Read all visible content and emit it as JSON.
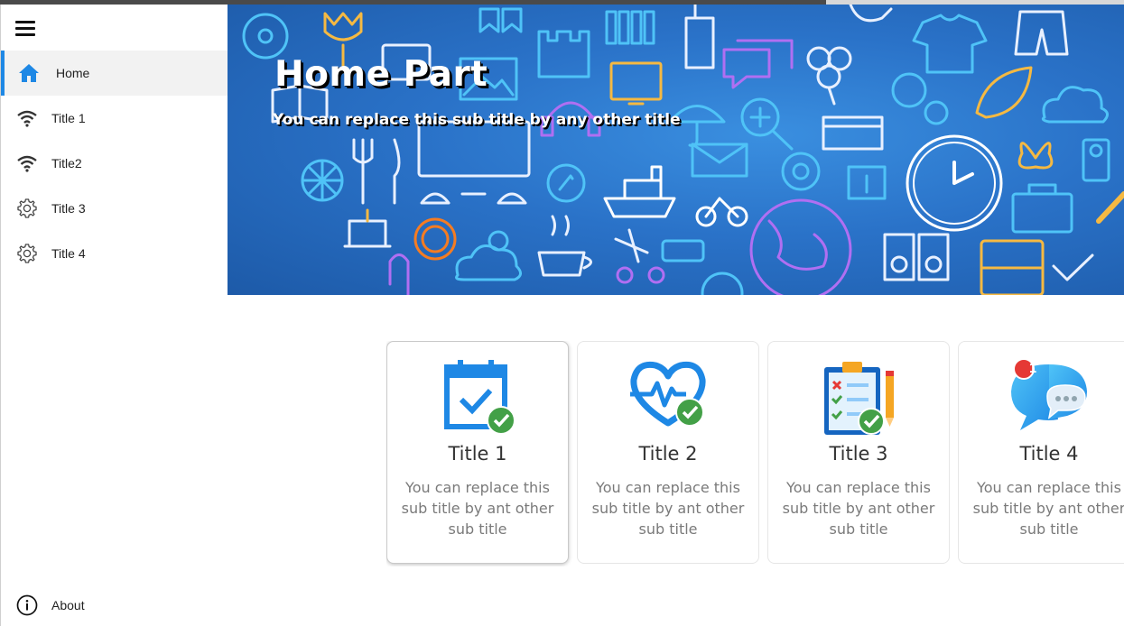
{
  "nav": {
    "items": [
      {
        "label": "Home",
        "icon": "home-icon",
        "active": true
      },
      {
        "label": "Title 1",
        "icon": "wifi-icon"
      },
      {
        "label": "Title2",
        "icon": "wifi-icon"
      },
      {
        "label": "Title 3",
        "icon": "gear-icon"
      },
      {
        "label": "Title 4",
        "icon": "gear-icon"
      }
    ],
    "about": {
      "label": "About",
      "icon": "info-icon"
    }
  },
  "hero": {
    "title": "Home Part",
    "subtitle": "You can replace this sub title by any other title"
  },
  "cards": [
    {
      "title": "Title 1",
      "sub": "You can replace this sub title by ant other sub title",
      "icon": "calendar-check-icon"
    },
    {
      "title": "Title 2",
      "sub": "You can replace this sub title by ant other sub title",
      "icon": "heart-pulse-icon"
    },
    {
      "title": "Title 3",
      "sub": "You can replace this sub title by ant other sub title",
      "icon": "clipboard-checklist-icon"
    },
    {
      "title": "Title 4",
      "sub": "You can replace this sub title by ant other sub title",
      "icon": "chat-bubbles-icon",
      "badge": "1"
    }
  ],
  "colors": {
    "accent": "#1e88e5",
    "hero_blue": "#2a72c8",
    "check_green": "#43a047"
  }
}
